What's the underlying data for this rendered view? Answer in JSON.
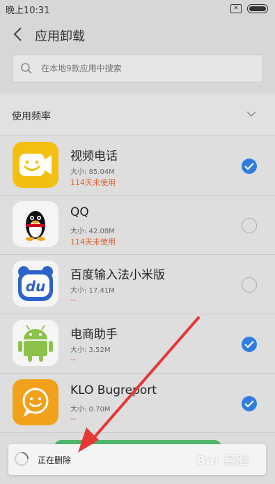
{
  "status": {
    "time": "晚上10:31"
  },
  "header": {
    "title": "应用卸载"
  },
  "search": {
    "placeholder": "在本地9款应用中搜索"
  },
  "sort": {
    "label": "使用频率"
  },
  "apps": [
    {
      "name": "视频电话",
      "size": "大小: 85.04M",
      "usage": "114天未使用",
      "checked": true,
      "icon": "video-call-icon"
    },
    {
      "name": "QQ",
      "size": "大小: 42.08M",
      "usage": "114天未使用",
      "checked": false,
      "icon": "qq-penguin-icon"
    },
    {
      "name": "百度输入法小米版",
      "size": "大小: 17.41M",
      "usage": "--",
      "checked": false,
      "icon": "baidu-input-icon"
    },
    {
      "name": "电商助手",
      "size": "大小: 3.52M",
      "usage": "--",
      "checked": true,
      "icon": "android-robot-icon"
    },
    {
      "name": "KLO Bugreport",
      "size": "大小: 0.70M",
      "usage": "--",
      "checked": true,
      "icon": "chat-smile-icon"
    }
  ],
  "toast": {
    "message": "正在删除"
  },
  "colors": {
    "accent": "#2f7de0",
    "usage_text": "#e0622b",
    "arrow": "#e53935",
    "uninstall_button": "#4fb86b"
  }
}
